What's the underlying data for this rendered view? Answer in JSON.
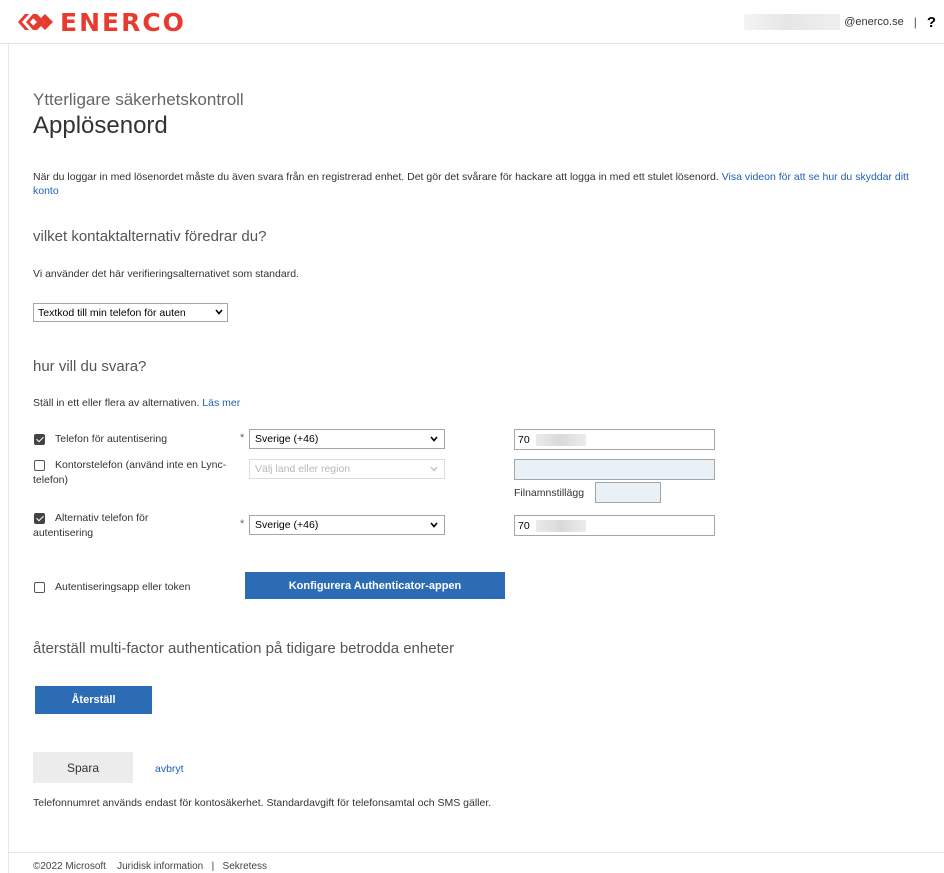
{
  "header": {
    "brand": "ENERCO",
    "brand_color": "#e63b2e",
    "user_domain": "@enerco.se",
    "separator": "|",
    "help_label": "?"
  },
  "page": {
    "subtitle": "Ytterligare säkerhetskontroll",
    "title": "Applösenord",
    "description": "När du loggar in med lösenordet måste du även svara från en registrerad enhet. Det gör det svårare för hackare att logga in med ett stulet lösenord. ",
    "video_link": "Visa videon för att se hur du skyddar ditt konto"
  },
  "contact": {
    "heading": "vilket kontaktalternativ föredrar du?",
    "text": "Vi använder det här verifieringsalternativet som standard.",
    "selected": "Textkod till min telefon för auten"
  },
  "answer": {
    "heading": "hur vill du svara?",
    "text": "Ställ in ett eller flera av alternativen. ",
    "learn_more": "Läs mer",
    "rows": [
      {
        "label": "Telefon för autentisering",
        "checked": true,
        "required": "*",
        "country": "Sverige (+46)",
        "phone": "70"
      },
      {
        "label": "Kontorstelefon (använd inte en Lync-telefon)",
        "checked": false,
        "country_placeholder": "Välj land eller region",
        "extension_label": "Filnamnstillägg"
      },
      {
        "label": "Alternativ telefon för autentisering",
        "checked": true,
        "required": "*",
        "country": "Sverige (+46)",
        "phone": "70"
      }
    ],
    "app_label": "Autentiseringsapp eller token",
    "app_checked": false,
    "configure_button": "Konfigurera Authenticator-appen"
  },
  "reset": {
    "heading": "återställ multi-factor authentication på tidigare betrodda enheter",
    "button": "Återställ"
  },
  "actions": {
    "save": "Spara",
    "cancel": "avbryt",
    "note": "Telefonnumret används endast för kontosäkerhet. Standardavgift för telefonsamtal och SMS gäller."
  },
  "footer": {
    "copyright": "©2022 Microsoft",
    "legal": "Juridisk information",
    "separator": "|",
    "privacy": "Sekretess"
  },
  "colors": {
    "accent": "#2b6cb5",
    "link": "#2062b4"
  }
}
